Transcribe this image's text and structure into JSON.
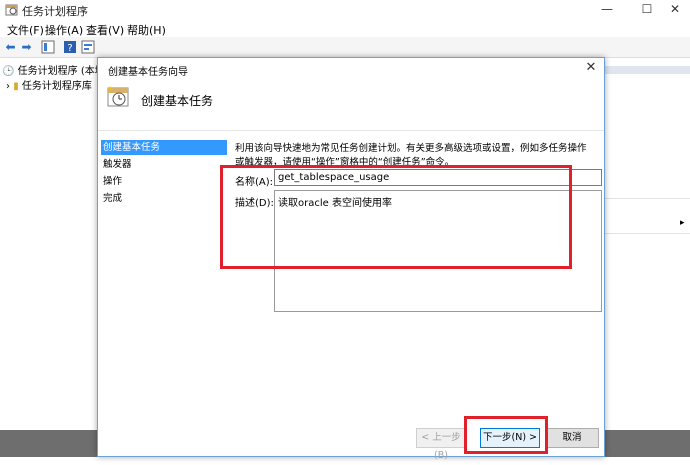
{
  "window": {
    "title": "任务计划程序",
    "controls": {
      "minimize": "—",
      "maximize": "☐",
      "close": "✕"
    }
  },
  "menubar": {
    "items": [
      "文件(F)",
      "操作(A)",
      "查看(V)",
      "帮助(H)"
    ]
  },
  "tree": {
    "items": [
      "任务计划程序 (本地)",
      "任务计划程序库"
    ]
  },
  "dialog": {
    "title": "创建基本任务向导",
    "header_title": "创建基本任务",
    "steps": [
      "创建基本任务",
      "触发器",
      "操作",
      "完成"
    ],
    "active_step": 0,
    "intro": "利用该向导快速地为常见任务创建计划。有关更多高级选项或设置，例如多任务操作或触发器，请使用“操作”窗格中的“创建任务”命令。",
    "name_label": "名称(A):",
    "name_value": "get_tablespace_usage",
    "desc_label": "描述(D):",
    "desc_value": "读取oracle 表空间使用率",
    "buttons": {
      "back": "< 上一步(B)",
      "next": "下一步(N) >",
      "cancel": "取消"
    }
  },
  "colors": {
    "highlight": "#e0202a",
    "selection": "#3399ff"
  }
}
